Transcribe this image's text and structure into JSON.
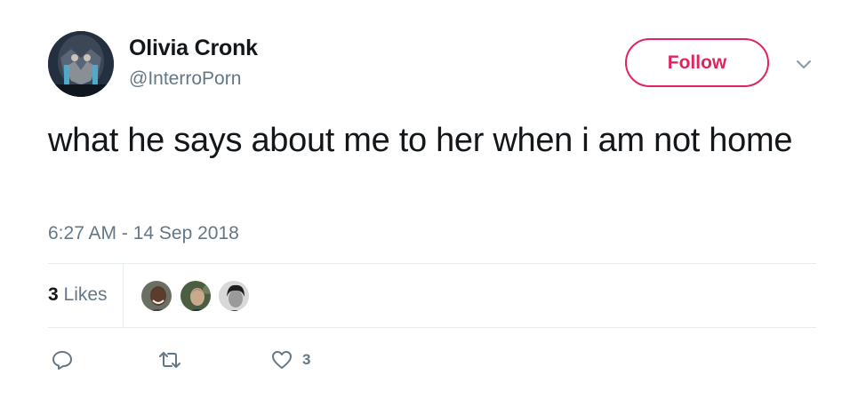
{
  "tweet": {
    "author": {
      "name": "Olivia Cronk",
      "handle": "@InterroPorn",
      "avatar_icon": "user-avatar"
    },
    "follow_label": "Follow",
    "text": "what he says about me to her when i am not home",
    "timestamp": "6:27 AM - 14 Sep 2018",
    "stats": {
      "likes_number": "3",
      "likes_label": "Likes",
      "likers": [
        "liker-avatar-1",
        "liker-avatar-2",
        "liker-avatar-3"
      ]
    },
    "actions": {
      "reply_icon": "reply-icon",
      "retweet_icon": "retweet-icon",
      "like_icon": "heart-icon",
      "like_count": "3"
    }
  },
  "colors": {
    "accent": "#e0245e",
    "text_primary": "#14171a",
    "text_secondary": "#657786",
    "divider": "#e6ecf0"
  }
}
